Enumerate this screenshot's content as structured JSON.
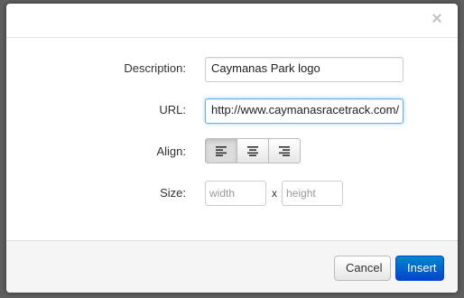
{
  "dialog": {
    "close_symbol": "×"
  },
  "form": {
    "description": {
      "label": "Description:",
      "value": "Caymanas Park logo"
    },
    "url": {
      "label": "URL:",
      "value": "http://www.caymanasracetrack.com/"
    },
    "align": {
      "label": "Align:",
      "options": [
        "left",
        "center",
        "right"
      ],
      "selected": "left"
    },
    "size": {
      "label": "Size:",
      "width_placeholder": "width",
      "height_placeholder": "height",
      "separator": "x"
    }
  },
  "footer": {
    "cancel_label": "Cancel",
    "insert_label": "Insert"
  },
  "colors": {
    "primary": "#0066cc",
    "focus_border": "#66afe9"
  },
  "icons": {
    "close": "close-icon",
    "align_left": "align-left-icon",
    "align_center": "align-center-icon",
    "align_right": "align-right-icon"
  }
}
